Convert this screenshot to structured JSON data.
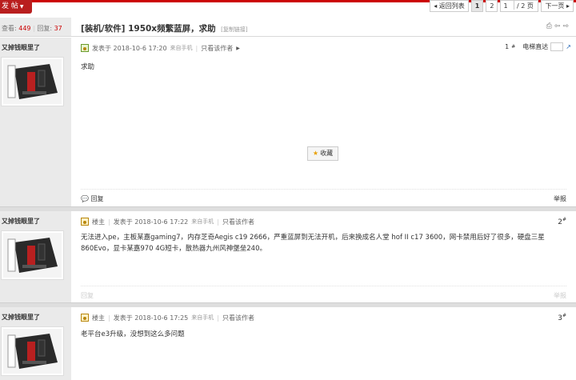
{
  "topbar": {
    "post_button": "发 帖",
    "pager": {
      "back_label": "◂ 返回列表",
      "pages": [
        "1",
        "2"
      ],
      "current_page": "1",
      "jump_value": "1",
      "total_label": "/ 2 页",
      "next_label": "下一页 ▸"
    }
  },
  "thread": {
    "views_label": "查看:",
    "views": "449",
    "replies_label": "回复:",
    "replies": "37",
    "title": "[装机/软件] 1950x频繁蓝屏，求助",
    "copy_link": "[复制链接]"
  },
  "posts": [
    {
      "username": "又掉钱眼里了",
      "author_tag": "",
      "posted": "发表于 2018-10-6 17:20",
      "source": "来自手机",
      "only_author": "只看该作者",
      "floor": "1",
      "floor_suffix": "#",
      "elevator_label": "电梯直达",
      "content": "求助",
      "favorite": "收藏",
      "reply": "回复",
      "report": "举报"
    },
    {
      "username": "又掉钱眼里了",
      "author_tag": "楼主",
      "posted": "发表于 2018-10-6 17:22",
      "source": "来自手机",
      "only_author": "只看该作者",
      "floor": "2",
      "floor_suffix": "#",
      "content": "无法进入pe，主板某嘉gaming7，内存芝奇Aegis c19  2666，严重蓝屏到无法开机，后来换成名人堂 hof II c17 3600，网卡禁用后好了很多，硬盘三星860Evo，显卡某嘉970 4G短卡，散热器九州风神堡垒240。",
      "reply": "回复",
      "report": "举报"
    },
    {
      "username": "又掉钱眼里了",
      "author_tag": "楼主",
      "posted": "发表于 2018-10-6 17:25",
      "source": "来自手机",
      "only_author": "只看该作者",
      "floor": "3",
      "floor_suffix": "#",
      "content": "老平台e3升级，没想到这么多问题"
    }
  ],
  "colors": {
    "accent": "#c00000",
    "sidebar": "#eaeaea"
  }
}
